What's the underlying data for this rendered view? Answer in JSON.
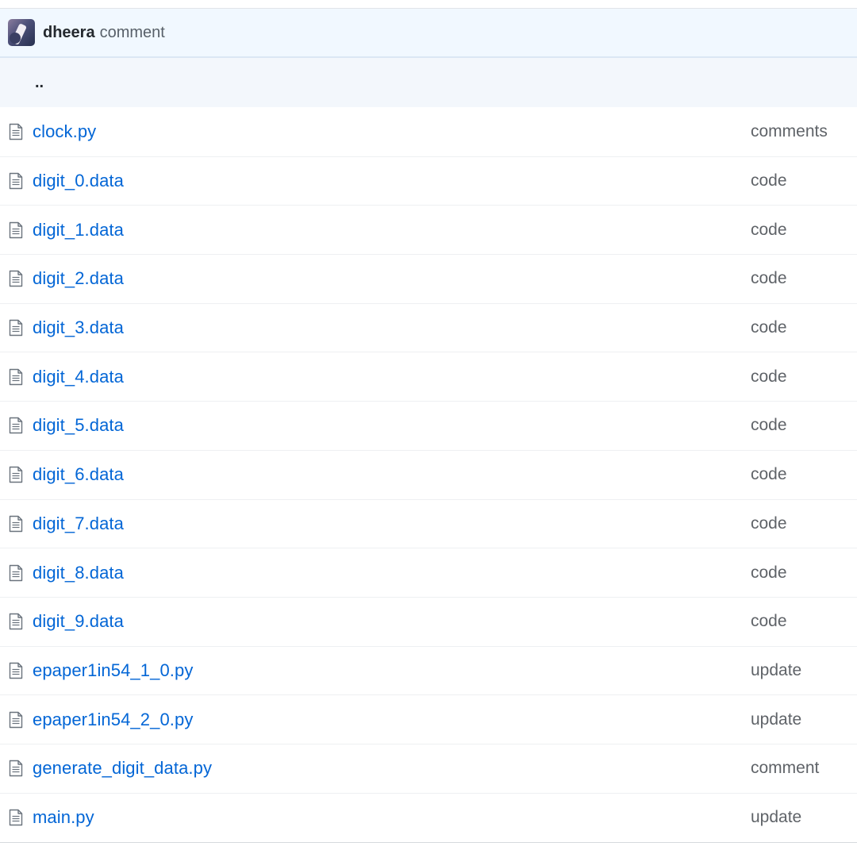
{
  "commit": {
    "author": "dheera",
    "message": "comment"
  },
  "parent_dir": "..",
  "files": [
    {
      "name": "clock.py",
      "message": "comments",
      "icon": "file-icon"
    },
    {
      "name": "digit_0.data",
      "message": "code",
      "icon": "file-icon"
    },
    {
      "name": "digit_1.data",
      "message": "code",
      "icon": "file-icon"
    },
    {
      "name": "digit_2.data",
      "message": "code",
      "icon": "file-icon"
    },
    {
      "name": "digit_3.data",
      "message": "code",
      "icon": "file-icon"
    },
    {
      "name": "digit_4.data",
      "message": "code",
      "icon": "file-icon"
    },
    {
      "name": "digit_5.data",
      "message": "code",
      "icon": "file-icon"
    },
    {
      "name": "digit_6.data",
      "message": "code",
      "icon": "file-icon"
    },
    {
      "name": "digit_7.data",
      "message": "code",
      "icon": "file-icon"
    },
    {
      "name": "digit_8.data",
      "message": "code",
      "icon": "file-icon"
    },
    {
      "name": "digit_9.data",
      "message": "code",
      "icon": "file-icon"
    },
    {
      "name": "epaper1in54_1_0.py",
      "message": "update",
      "icon": "file-icon"
    },
    {
      "name": "epaper1in54_2_0.py",
      "message": "update",
      "icon": "file-icon"
    },
    {
      "name": "generate_digit_data.py",
      "message": "comment",
      "icon": "file-icon"
    },
    {
      "name": "main.py",
      "message": "update",
      "icon": "file-icon"
    }
  ],
  "colors": {
    "link": "#0366d6",
    "commit_bar_bg": "#f1f8ff",
    "muted_text": "#5f6368"
  }
}
